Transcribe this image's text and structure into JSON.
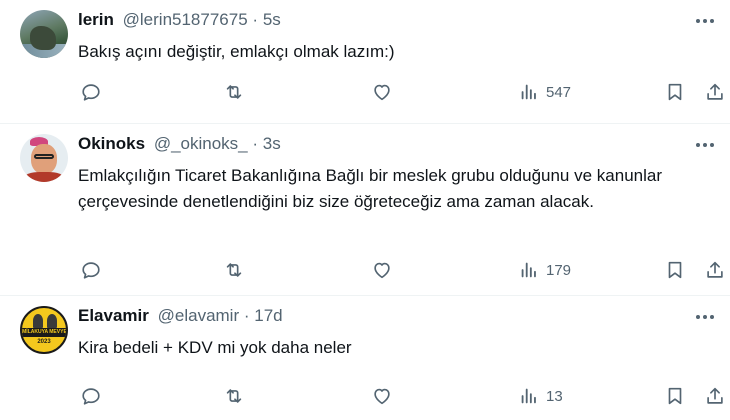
{
  "tweets": [
    {
      "name": "lerin",
      "handle": "@lerin51877675",
      "dot": "·",
      "time": "5s",
      "text": "Bakış açını değiştir, emlakçı olmak lazım:)",
      "views": "547"
    },
    {
      "name": "Okinoks",
      "handle": "@_okinoks_",
      "dot": "·",
      "time": "3s",
      "text": "Emlakçılığın Ticaret Bakanlığına Bağlı bir meslek grubu olduğunu ve kanunlar çerçevesinde denetlendiğini biz size öğreteceğiz ama zaman alacak.",
      "views": "179"
    },
    {
      "name": "Elavamir",
      "handle": "@elavamir",
      "dot": "·",
      "time": "17d",
      "text": "Kira bedeli + KDV mi yok daha neler",
      "views": "13",
      "avatar_badge": "MİLAKUYA MEVYE !",
      "avatar_year": "2023"
    }
  ],
  "icons": {
    "reply": "reply-icon",
    "retweet": "retweet-icon",
    "like": "like-icon",
    "views": "views-icon",
    "bookmark": "bookmark-icon",
    "share": "share-icon",
    "more": "more-icon"
  },
  "colors": {
    "text": "#0f1419",
    "secondary": "#536471",
    "divider": "#eff3f4"
  }
}
